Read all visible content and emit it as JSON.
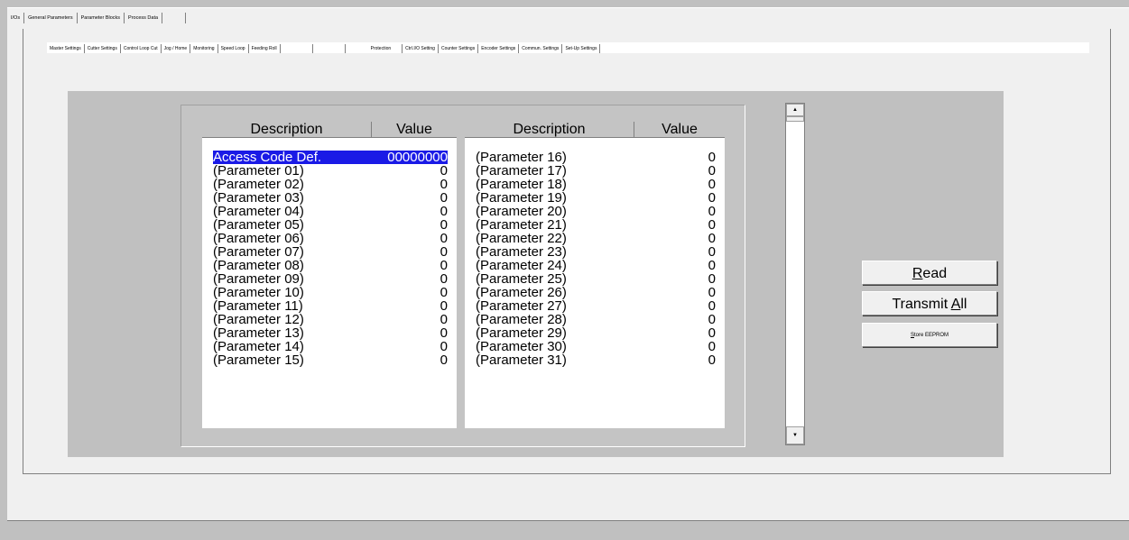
{
  "outer_tabs": [
    "I/Os",
    "General Parameters",
    "Parameter Blocks",
    "Process Data",
    ""
  ],
  "inner_tabs": [
    "Master Settings",
    "Cutter Settings",
    "Control Loop Cut",
    "Jog / Home",
    "Monitoring",
    "Speed Loop",
    "Feeding Roll",
    "",
    "",
    "Protection",
    "Ctrl.I/O Setting",
    "Counter Settings",
    "Encoder Settings",
    "Commun. Settings",
    "Set-Up Settings"
  ],
  "table": {
    "left_header": {
      "description": "Description",
      "value": "Value"
    },
    "right_header": {
      "description": "Description",
      "value": "Value"
    },
    "left_rows": [
      {
        "description": "Access Code Def.",
        "value": "00000000",
        "selected": true
      },
      {
        "description": "(Parameter 01)",
        "value": "0"
      },
      {
        "description": "(Parameter 02)",
        "value": "0"
      },
      {
        "description": "(Parameter 03)",
        "value": "0"
      },
      {
        "description": "(Parameter 04)",
        "value": "0"
      },
      {
        "description": "(Parameter 05)",
        "value": "0"
      },
      {
        "description": "(Parameter 06)",
        "value": "0"
      },
      {
        "description": "(Parameter 07)",
        "value": "0"
      },
      {
        "description": "(Parameter 08)",
        "value": "0"
      },
      {
        "description": "(Parameter 09)",
        "value": "0"
      },
      {
        "description": "(Parameter 10)",
        "value": "0"
      },
      {
        "description": "(Parameter 11)",
        "value": "0"
      },
      {
        "description": "(Parameter 12)",
        "value": "0"
      },
      {
        "description": "(Parameter 13)",
        "value": "0"
      },
      {
        "description": "(Parameter 14)",
        "value": "0"
      },
      {
        "description": "(Parameter 15)",
        "value": "0"
      }
    ],
    "right_rows": [
      {
        "description": "(Parameter 16)",
        "value": "0"
      },
      {
        "description": "(Parameter 17)",
        "value": "0"
      },
      {
        "description": "(Parameter 18)",
        "value": "0"
      },
      {
        "description": "(Parameter 19)",
        "value": "0"
      },
      {
        "description": "(Parameter 20)",
        "value": "0"
      },
      {
        "description": "(Parameter 21)",
        "value": "0"
      },
      {
        "description": "(Parameter 22)",
        "value": "0"
      },
      {
        "description": "(Parameter 23)",
        "value": "0"
      },
      {
        "description": "(Parameter 24)",
        "value": "0"
      },
      {
        "description": "(Parameter 25)",
        "value": "0"
      },
      {
        "description": "(Parameter 26)",
        "value": "0"
      },
      {
        "description": "(Parameter 27)",
        "value": "0"
      },
      {
        "description": "(Parameter 28)",
        "value": "0"
      },
      {
        "description": "(Parameter 29)",
        "value": "0"
      },
      {
        "description": "(Parameter 30)",
        "value": "0"
      },
      {
        "description": "(Parameter 31)",
        "value": "0"
      }
    ]
  },
  "buttons": {
    "read": {
      "mnemonic": "R",
      "rest": "ead"
    },
    "transmit": {
      "prefix": "Transmit ",
      "mnemonic": "A",
      "rest": "ll"
    },
    "store": {
      "mnemonic": "S",
      "rest": "tore EEPROM"
    }
  },
  "scrollbar": {
    "up_icon": "arrow-up-icon",
    "down_icon": "arrow-down-icon"
  },
  "colors": {
    "selection": "#1a1ae6",
    "face": "#f0f0f0",
    "background": "#c0c0c0"
  }
}
